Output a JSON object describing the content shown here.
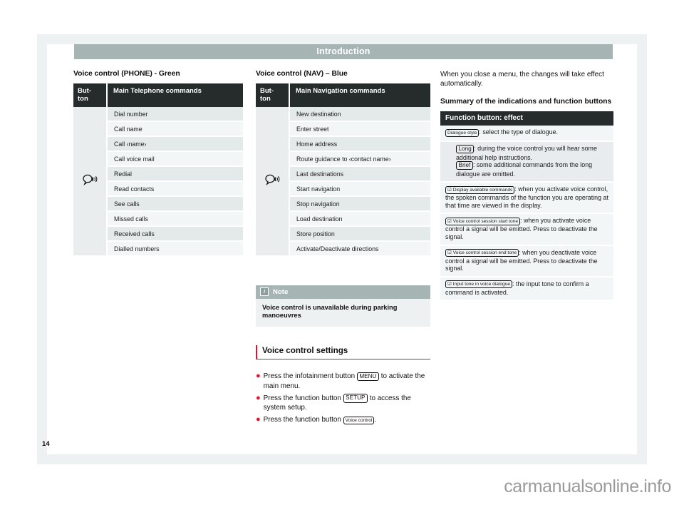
{
  "page": {
    "running_head": "Introduction",
    "folio": "14",
    "watermark": "carmanualsonline.info",
    "accent_red": "#e8112d",
    "header_grey": "#a7b4b4",
    "table_header_dark": "#262b2b"
  },
  "left_column": {
    "title": "Voice control (PHONE) - Green",
    "table": {
      "header_button": "But-\nton",
      "header_button_line1": "But-",
      "header_button_line2": "ton",
      "header_commands": "Main Telephone commands",
      "button_icon": "voice-control-icon",
      "rows": [
        "Dial number",
        "Call name",
        "Call ‹name›",
        "Call voice mail",
        "Redial",
        "Read contacts",
        "See calls",
        "Missed calls",
        "Received calls",
        "Dialled numbers"
      ]
    }
  },
  "middle_column": {
    "title": "Voice control (NAV) – Blue",
    "table": {
      "header_button_line1": "But-",
      "header_button_line2": "ton",
      "header_commands": "Main Navigation commands",
      "button_icon": "voice-control-icon",
      "rows": [
        "New destination",
        "Enter street",
        "Home address",
        "Route guidance to ‹contact name›",
        "Last destinations",
        "Start navigation",
        "Stop navigation",
        "Load destination",
        "Store position",
        "Activate/Deactivate directions"
      ]
    },
    "note": {
      "icon": "info-icon",
      "label": "Note",
      "body": "Voice control is unavailable during parking manoeuvres"
    },
    "section": {
      "title": "Voice control settings",
      "bullets": [
        {
          "pre": "Press the infotainment button ",
          "chip": "MENU",
          "post": " to activate the main menu."
        },
        {
          "pre": "Press the function button ",
          "chip": "SETUP",
          "post": " to access the system setup."
        },
        {
          "pre": "Press the function button ",
          "chip": "Voice control",
          "post": "."
        }
      ]
    }
  },
  "right_column": {
    "intro_paragraph": "When you close a menu, the changes will take effect automatically.",
    "subheading": "Summary of the indications and function buttons",
    "table": {
      "header": "Function button: effect",
      "rows": [
        {
          "indent": false,
          "chip": "Dialogue style",
          "chip_checkbox": false,
          "text": ": select the type of dialogue.",
          "extra_chip": null,
          "extra_text": null
        },
        {
          "indent": true,
          "chip": "Long",
          "chip_checkbox": false,
          "text": ": during the voice control you will hear some additional help instructions.",
          "extra_chip": "Brief",
          "extra_text": ": some additional commands from the long dialogue are omitted."
        },
        {
          "indent": false,
          "chip": "Display available commands",
          "chip_checkbox": true,
          "text": ": when you activate voice control, the spoken commands of the function you are operating at that time are viewed in the display.",
          "extra_chip": null,
          "extra_text": null
        },
        {
          "indent": false,
          "chip": "Voice control session start tone",
          "chip_checkbox": true,
          "text": ": when you activate voice control a signal will be emitted. Press to deactivate the signal.",
          "extra_chip": null,
          "extra_text": null
        },
        {
          "indent": false,
          "chip": "Voice control session end tone",
          "chip_checkbox": true,
          "text": ": when you deactivate voice control a signal will be emitted. Press to deactivate the signal.",
          "extra_chip": null,
          "extra_text": null
        },
        {
          "indent": false,
          "chip": "Input tone in voice dialogue",
          "chip_checkbox": true,
          "text": ": the input tone to confirm a command is activated.",
          "extra_chip": null,
          "extra_text": null
        }
      ]
    }
  }
}
